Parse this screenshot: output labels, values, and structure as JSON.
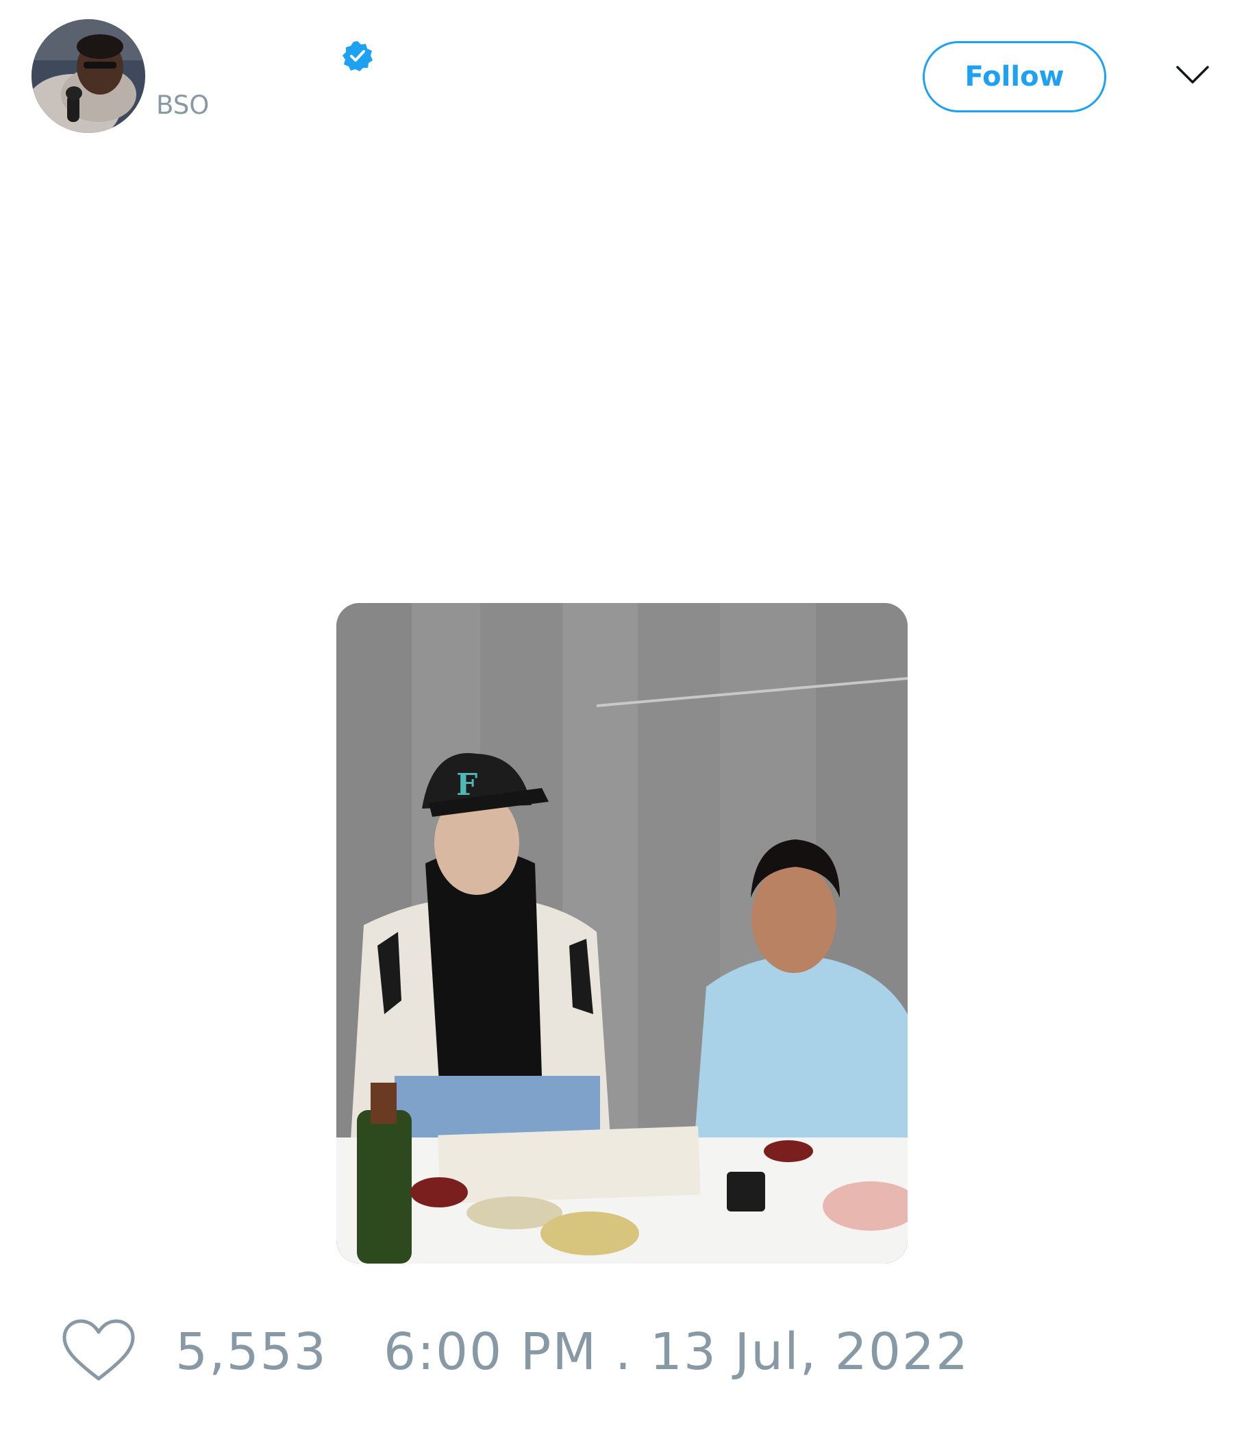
{
  "tweet": {
    "author": {
      "display_name": "",
      "handle": "BSO",
      "avatar_icon": "avatar-photo",
      "verified": true,
      "verified_color": "#1da1f2"
    },
    "follow_label": "Follow",
    "menu_icon": "chevron-down-icon",
    "media": {
      "type": "photo"
    },
    "like_count": "5,553",
    "timestamp": "6:00 PM . 13 Jul, 2022"
  },
  "colors": {
    "accent": "#1da1f2",
    "muted_text": "#8899a6"
  }
}
